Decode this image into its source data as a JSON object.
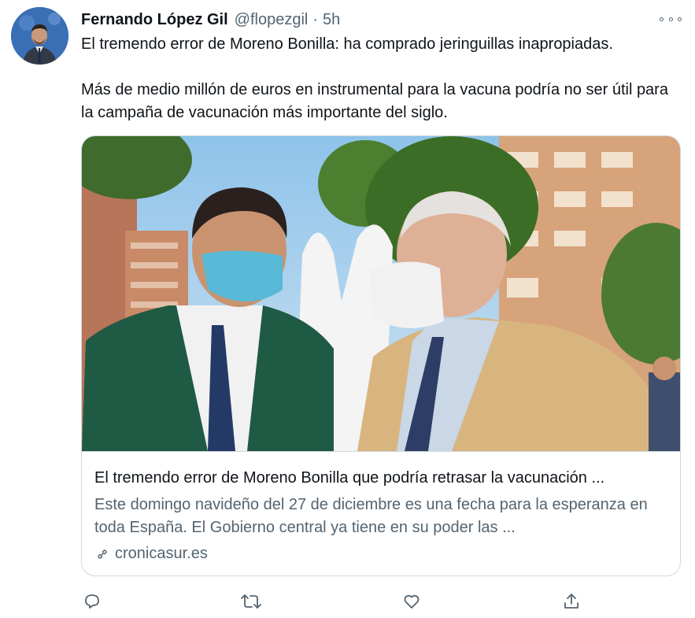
{
  "tweet": {
    "author_name": "Fernando López Gil",
    "handle": "@flopezgil",
    "separator": "·",
    "time": "5h",
    "paragraphs": [
      "El tremendo error de Moreno Bonilla: ha comprado jeringuillas inapropiadas.",
      "Más de medio millón de euros en instrumental para la vacuna podría no ser útil para la campaña de vacunación más importante del siglo."
    ]
  },
  "card": {
    "title": "El tremendo error de Moreno Bonilla que podría retrasar la vacunación ...",
    "description": "Este domingo navideño del 27 de diciembre es una fecha para la esperanza en toda España. El Gobierno central ya tiene en su poder las ...",
    "domain": "cronicasur.es"
  },
  "icons": {
    "more": "more-horizontal-icon",
    "reply": "reply-icon",
    "retweet": "retweet-icon",
    "like": "heart-icon",
    "share": "share-icon",
    "link": "link-icon"
  },
  "colors": {
    "text_primary": "#0f1419",
    "text_secondary": "#536471",
    "border": "#cfd9de"
  }
}
